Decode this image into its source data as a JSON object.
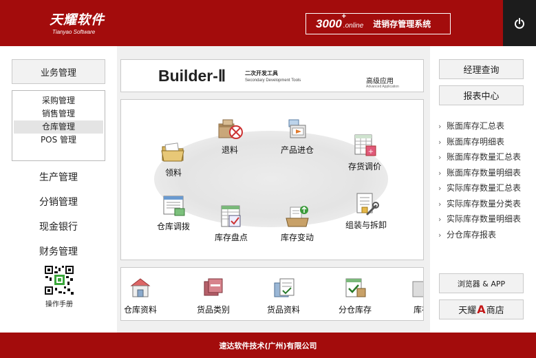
{
  "header": {
    "logo_cn": "天耀软件",
    "logo_en": "Tianyao Software",
    "product_number": "3000",
    "product_plus": "+",
    "product_online": ".online",
    "product_name": "进销存管理系统"
  },
  "left": {
    "section_button": "业务管理",
    "submenu": [
      "采购管理",
      "销售管理",
      "仓库管理",
      "POS 管理"
    ],
    "submenu_active": "仓库管理",
    "main_menu": [
      "生产管理",
      "分销管理",
      "现金银行",
      "财务管理"
    ],
    "qr_label": "操作手册"
  },
  "center": {
    "builder_title": "Builder-Ⅱ",
    "builder_sub_cn": "二次开发工具",
    "builder_sub_en": "Secondary Development Tools",
    "builder_adv_cn": "高级应用",
    "builder_adv_en": "Advanced Application",
    "flow": {
      "tuiliao": "退料",
      "chanpin": "产品进仓",
      "lingliao": "领料",
      "cunhuo": "存货调价",
      "diaobo": "仓库调拨",
      "zuzhuang": "组装与拆卸",
      "pandian": "库存盘点",
      "biandong": "库存变动"
    },
    "bottom": [
      "仓库资料",
      "货品类别",
      "货品资料",
      "分仓库存",
      "库存"
    ]
  },
  "right": {
    "manager_query": "经理查询",
    "report_center": "报表中心",
    "reports": [
      "账面库存汇总表",
      "账面库存明细表",
      "账面库存数量汇总表",
      "账面库存数量明细表",
      "实际库存数量汇总表",
      "实际库存数量分类表",
      "实际库存数量明细表",
      "分仓库存报表"
    ],
    "browser_app": "浏览器 & APP",
    "shop_prefix": "天耀",
    "shop_letter": "A",
    "shop_suffix": "商店"
  },
  "footer": {
    "company": "速达软件技术(广州)有限公司"
  },
  "colors": {
    "brand_red": "#a30c0c",
    "dark": "#1c1c1c",
    "panel_gray": "#f0f0f0"
  }
}
